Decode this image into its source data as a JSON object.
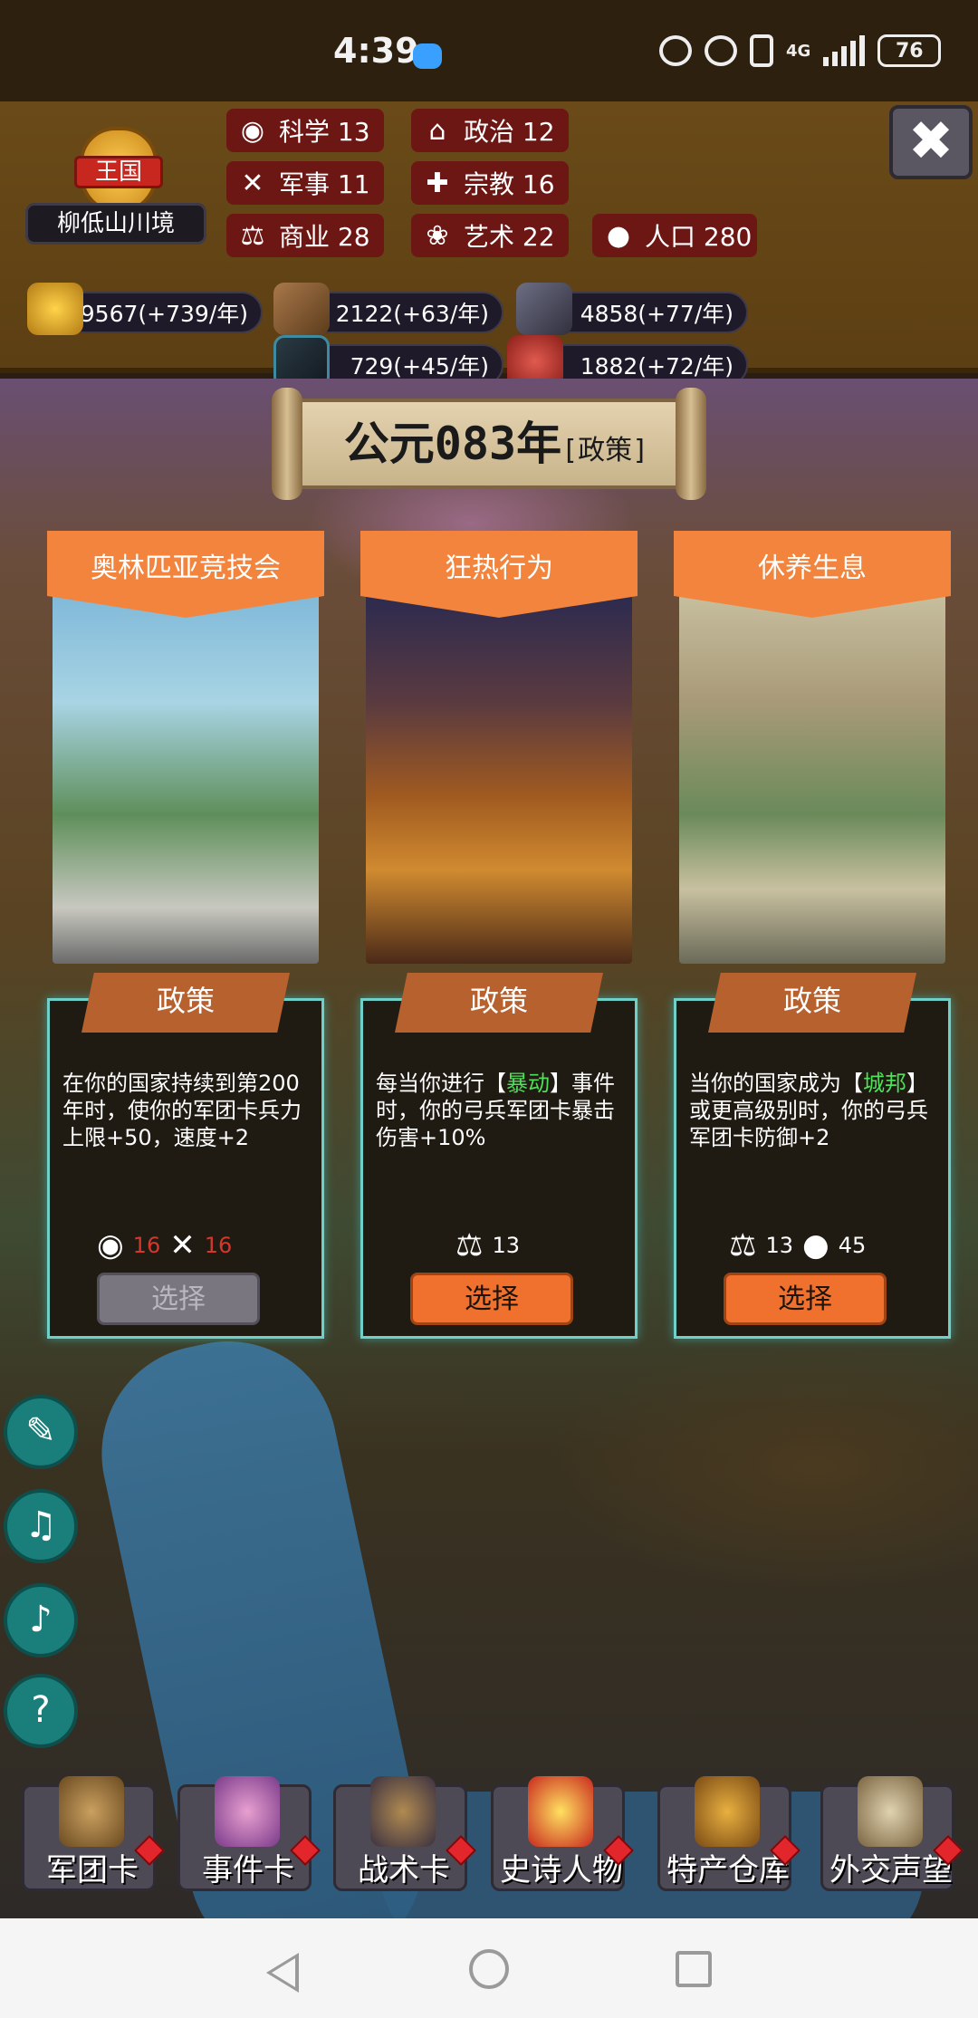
{
  "status_bar": {
    "time": "4:39",
    "network": "4G",
    "battery": "76"
  },
  "header": {
    "nation_type": "王国",
    "region_name": "柳低山川境",
    "stats": [
      {
        "label": "科学 13",
        "icon": "planet-icon"
      },
      {
        "label": "政治 12",
        "icon": "government-building-icon"
      },
      {
        "label": "军事 11",
        "icon": "crossed-weapons-icon"
      },
      {
        "label": "宗教 16",
        "icon": "cross-icon"
      },
      {
        "label": "商业 28",
        "icon": "scales-icon"
      },
      {
        "label": "艺术 22",
        "icon": "lotus-icon"
      },
      {
        "label": "人口 280",
        "icon": "person-icon"
      }
    ],
    "resources": [
      {
        "value": "119567(+739/年)",
        "icon": "gold-coins-icon"
      },
      {
        "value": "2122(+63/年)",
        "icon": "wood-logs-icon"
      },
      {
        "value": "4858(+77/年)",
        "icon": "stone-icon"
      },
      {
        "value": "729(+45/年)",
        "icon": "iron-ore-icon"
      },
      {
        "value": "1882(+72/年)",
        "icon": "meat-icon"
      }
    ]
  },
  "scroll": {
    "year": "公元083年",
    "mode": "[政策]"
  },
  "cards": [
    {
      "title": "奥林匹亚竞技会",
      "tag": "政策",
      "desc_parts": [
        "在你的国家持续到第200年时，使你的军团卡兵力上限+50，速度+2"
      ],
      "highlight": "",
      "desc_after": "",
      "costs": [
        {
          "icon": "planet-icon",
          "value": "16"
        },
        {
          "icon": "crossed-weapons-icon",
          "value": "16"
        }
      ],
      "button": "选择",
      "enabled": false
    },
    {
      "title": "狂热行为",
      "tag": "政策",
      "desc_before": "每当你进行【",
      "highlight": "暴动",
      "desc_after": "】事件时，你的弓兵军团卡暴击伤害+10%",
      "costs": [
        {
          "icon": "scales-icon",
          "value": "13"
        }
      ],
      "button": "选择",
      "enabled": true
    },
    {
      "title": "休养生息",
      "tag": "政策",
      "desc_before": "当你的国家成为【",
      "highlight": "城邦",
      "desc_after": "】或更高级别时，你的弓兵军团卡防御+2",
      "costs": [
        {
          "icon": "scales-icon",
          "value": "13"
        },
        {
          "icon": "person-icon",
          "value": "45"
        }
      ],
      "button": "选择",
      "enabled": true
    }
  ],
  "side_buttons": [
    "edit-note-icon",
    "music-off-icon",
    "sound-off-icon",
    "help-icon"
  ],
  "help_symbol": "?",
  "bottom_nav": [
    {
      "label": "军团卡",
      "icon": "helmet-icon"
    },
    {
      "label": "事件卡",
      "icon": "scroll-icon"
    },
    {
      "label": "战术卡",
      "icon": "crest-icon"
    },
    {
      "label": "史诗人物",
      "icon": "crown-icon"
    },
    {
      "label": "特产仓库",
      "icon": "treasure-chest-icon"
    },
    {
      "label": "外交声望",
      "icon": "envelope-icon"
    }
  ],
  "close_label": "✖"
}
